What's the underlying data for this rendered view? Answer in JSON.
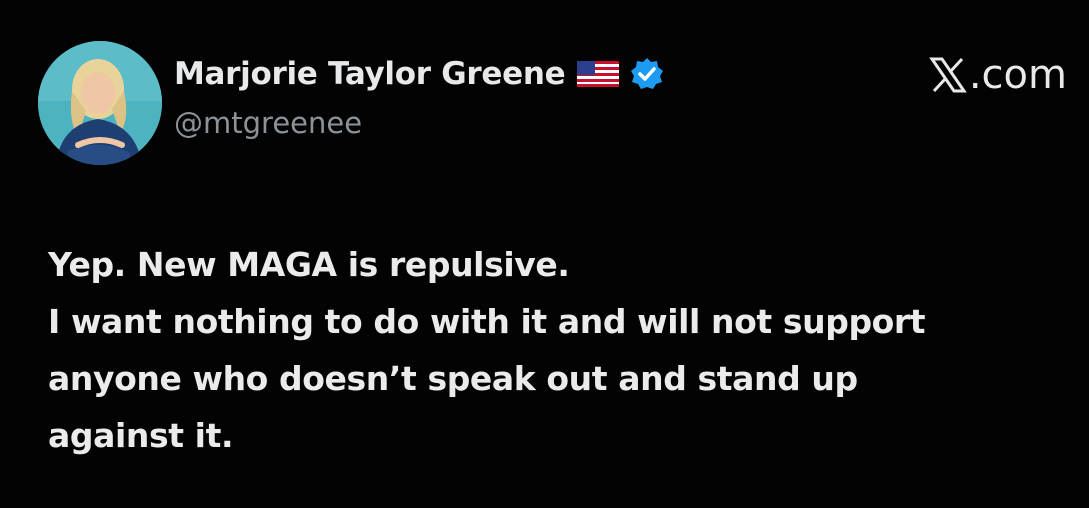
{
  "author": {
    "name": "Marjorie Taylor Greene",
    "handle": "@mtgreenee",
    "flag_icon": "us-flag-icon",
    "verified_icon": "verified-badge-icon"
  },
  "source": {
    "logo_icon": "x-logo-icon",
    "suffix": ".com"
  },
  "tweet": {
    "lines": [
      "Yep. New MAGA is repulsive.",
      "I want nothing to do with it and will not support",
      "anyone who doesn’t speak out and stand up",
      "against it."
    ]
  },
  "colors": {
    "background": "#000000",
    "text_primary": "#e7e9ea",
    "text_secondary": "#8b9298",
    "verified_blue": "#1d9bf0"
  }
}
